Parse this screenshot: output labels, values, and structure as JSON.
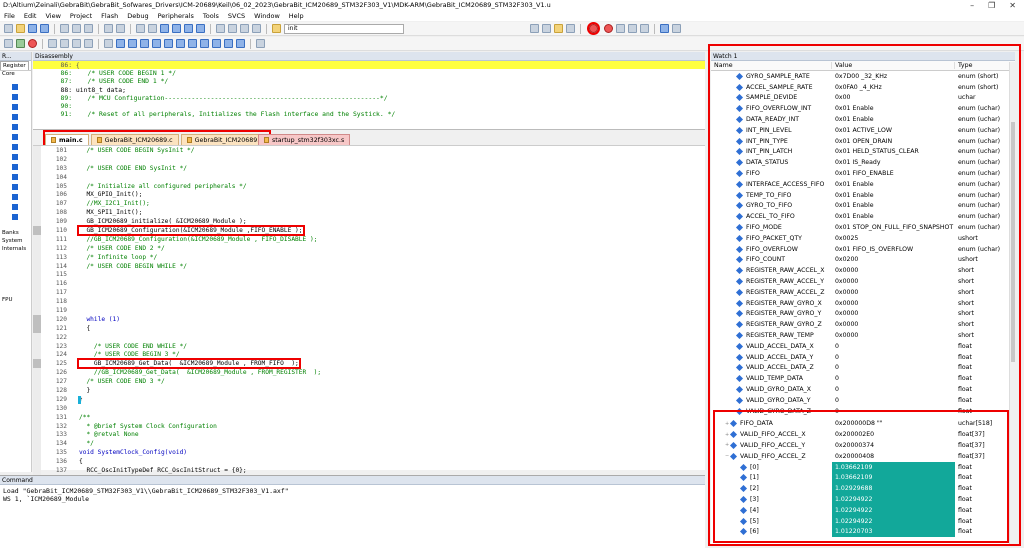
{
  "title": "D:\\Altium\\Zeinali\\GebraBit\\GebraBit_Sofwares_Drivers\\ICM-20689\\Keil\\06_02_2023\\GebraBit_ICM20689_STM32F303_V1\\MDK-ARM\\GebraBit_ICM20689_STM32F303_V1.u",
  "window_controls": [
    "–",
    "❐",
    "✕"
  ],
  "menu": [
    "File",
    "Edit",
    "View",
    "Project",
    "Flash",
    "Debug",
    "Peripherals",
    "Tools",
    "SVCS",
    "Window",
    "Help"
  ],
  "toolbar": {
    "find_value": "init"
  },
  "left_panel": {
    "header": "R...",
    "tab": "Register",
    "items": [
      "Core",
      "Banks",
      "System",
      "Internals",
      "FPU"
    ]
  },
  "disassembly": {
    "header": "Disassembly",
    "lines": [
      {
        "text": "   86: {"
      },
      {
        "text": "   86:    /* USER CODE BEGIN 1 */"
      },
      {
        "text": "   87:    /* USER CODE END 1 */"
      },
      {
        "text": "   88: uint8_t data;"
      },
      {
        "text": "   89:    /* MCU Configuration--------------------------------------------------------*/"
      },
      {
        "text": "   90:"
      },
      {
        "text": "   91:    /* Reset of all peripherals, Initializes the Flash interface and the Systick. */"
      }
    ]
  },
  "tabs": [
    {
      "label": "main.c"
    },
    {
      "label": "GebraBit_ICM20689.c"
    },
    {
      "label": "GebraBit_ICM20689.h"
    },
    {
      "label": "startup_stm32f303xc.s"
    }
  ],
  "editor": {
    "lines": [
      {
        "n": "101",
        "t": "  /* USER CODE BEGIN SysInit */"
      },
      {
        "n": "102",
        "t": ""
      },
      {
        "n": "103",
        "t": "  /* USER CODE END SysInit */"
      },
      {
        "n": "104",
        "t": ""
      },
      {
        "n": "105",
        "t": "  /* Initialize all configured peripherals */"
      },
      {
        "n": "106",
        "t": "  MX_GPIO_Init();"
      },
      {
        "n": "107",
        "t": "  //MX_I2C1_Init();"
      },
      {
        "n": "108",
        "t": "  MX_SPI1_Init();"
      },
      {
        "n": "109",
        "t": "  GB_ICM20689_initialize( &ICM20689_Module );"
      },
      {
        "n": "110",
        "t": "  GB_ICM20689_Configuration(&ICM20689_Module ,FIFO_ENABLE );"
      },
      {
        "n": "111",
        "t": "  //GB_ICM20689_Configuration(&ICM20689_Module , FIFO_DISABLE );"
      },
      {
        "n": "112",
        "t": "  /* USER CODE END 2 */"
      },
      {
        "n": "113",
        "t": "  /* Infinite loop */"
      },
      {
        "n": "114",
        "t": "  /* USER CODE BEGIN WHILE */"
      },
      {
        "n": "115",
        "t": ""
      },
      {
        "n": "116",
        "t": ""
      },
      {
        "n": "117",
        "t": ""
      },
      {
        "n": "118",
        "t": ""
      },
      {
        "n": "119",
        "t": ""
      },
      {
        "n": "120",
        "t": "  while (1)"
      },
      {
        "n": "121",
        "t": "  {"
      },
      {
        "n": "122",
        "t": ""
      },
      {
        "n": "123",
        "t": "    /* USER CODE END WHILE */"
      },
      {
        "n": "124",
        "t": "    /* USER CODE BEGIN 3 */"
      },
      {
        "n": "125",
        "t": "    GB_ICM20689_Get_Data(  &ICM20689_Module , FROM_FIFO  );"
      },
      {
        "n": "126",
        "t": "    //GB_ICM20689_Get_Data(  &ICM20689_Module , FROM_REGISTER  );"
      },
      {
        "n": "127",
        "t": "  /* USER CODE END 3 */"
      },
      {
        "n": "128",
        "t": "  }"
      },
      {
        "n": "129",
        "t": "}"
      },
      {
        "n": "130",
        "t": ""
      },
      {
        "n": "131",
        "t": "/**"
      },
      {
        "n": "132",
        "t": "  * @brief System Clock Configuration"
      },
      {
        "n": "133",
        "t": "  * @retval None"
      },
      {
        "n": "134",
        "t": "  */"
      },
      {
        "n": "135",
        "t": "void SystemClock_Config(void)"
      },
      {
        "n": "136",
        "t": "{"
      },
      {
        "n": "137",
        "t": "  RCC_OscInitTypeDef RCC_OscInitStruct = {0};"
      }
    ]
  },
  "command": {
    "header": "Command",
    "lines": [
      "Load \"GebraBit_ICM20689_STM32F303_V1\\\\GebraBit_ICM20689_STM32F303_V1.axf\"",
      "WS 1, `ICM20689_Module"
    ]
  },
  "watch": {
    "header": "Watch 1",
    "columns": [
      "Name",
      "Value",
      "Type"
    ],
    "rows": [
      {
        "name": "GYRO_SAMPLE_RATE",
        "value": "0x7D00 _32_KHz",
        "type": "enum (short)"
      },
      {
        "name": "ACCEL_SAMPLE_RATE",
        "value": "0x0FA0 _4_KHz",
        "type": "enum (short)"
      },
      {
        "name": "SAMPLE_DEVIDE",
        "value": "0x00",
        "type": "uchar"
      },
      {
        "name": "FIFO_OVERFLOW_INT",
        "value": "0x01 Enable",
        "type": "enum (uchar)"
      },
      {
        "name": "DATA_READY_INT",
        "value": "0x01 Enable",
        "type": "enum (uchar)"
      },
      {
        "name": "INT_PIN_LEVEL",
        "value": "0x01 ACTIVE_LOW",
        "type": "enum (uchar)"
      },
      {
        "name": "INT_PIN_TYPE",
        "value": "0x01 OPEN_DRAIN",
        "type": "enum (uchar)"
      },
      {
        "name": "INT_PIN_LATCH",
        "value": "0x01 HELD_STATUS_CLEAR",
        "type": "enum (uchar)"
      },
      {
        "name": "DATA_STATUS",
        "value": "0x01 IS_Ready",
        "type": "enum (uchar)"
      },
      {
        "name": "FIFO",
        "value": "0x01 FIFO_ENABLE",
        "type": "enum (uchar)"
      },
      {
        "name": "INTERFACE_ACCESS_FIFO",
        "value": "0x01 Enable",
        "type": "enum (uchar)"
      },
      {
        "name": "TEMP_TO_FIFO",
        "value": "0x01 Enable",
        "type": "enum (uchar)"
      },
      {
        "name": "GYRO_TO_FIFO",
        "value": "0x01 Enable",
        "type": "enum (uchar)"
      },
      {
        "name": "ACCEL_TO_FIFO",
        "value": "0x01 Enable",
        "type": "enum (uchar)"
      },
      {
        "name": "FIFO_MODE",
        "value": "0x01 STOP_ON_FULL_FIFO_SNAPSHOT",
        "type": "enum (uchar)"
      },
      {
        "name": "FIFO_PACKET_QTY",
        "value": "0x0025",
        "type": "ushort"
      },
      {
        "name": "FIFO_OVERFLOW",
        "value": "0x01 FIFO_IS_OVERFLOW",
        "type": "enum (uchar)"
      },
      {
        "name": "FIFO_COUNT",
        "value": "0x0200",
        "type": "ushort"
      },
      {
        "name": "REGISTER_RAW_ACCEL_X",
        "value": "0x0000",
        "type": "short"
      },
      {
        "name": "REGISTER_RAW_ACCEL_Y",
        "value": "0x0000",
        "type": "short"
      },
      {
        "name": "REGISTER_RAW_ACCEL_Z",
        "value": "0x0000",
        "type": "short"
      },
      {
        "name": "REGISTER_RAW_GYRO_X",
        "value": "0x0000",
        "type": "short"
      },
      {
        "name": "REGISTER_RAW_GYRO_Y",
        "value": "0x0000",
        "type": "short"
      },
      {
        "name": "REGISTER_RAW_GYRO_Z",
        "value": "0x0000",
        "type": "short"
      },
      {
        "name": "REGISTER_RAW_TEMP",
        "value": "0x0000",
        "type": "short"
      },
      {
        "name": "VALID_ACCEL_DATA_X",
        "value": "0",
        "type": "float"
      },
      {
        "name": "VALID_ACCEL_DATA_Y",
        "value": "0",
        "type": "float"
      },
      {
        "name": "VALID_ACCEL_DATA_Z",
        "value": "0",
        "type": "float"
      },
      {
        "name": "VALID_TEMP_DATA",
        "value": "0",
        "type": "float"
      },
      {
        "name": "VALID_GYRO_DATA_X",
        "value": "0",
        "type": "float"
      },
      {
        "name": "VALID_GYRO_DATA_Y",
        "value": "0",
        "type": "float"
      },
      {
        "name": "VALID_GYRO_DATA_Z",
        "value": "0",
        "type": "float"
      }
    ],
    "expanded_rows": [
      {
        "name": "FIFO_DATA",
        "value": "0x200000D8 \"\"",
        "type": "uchar[518]"
      },
      {
        "name": "VALID_FIFO_ACCEL_X",
        "value": "0x200002E0",
        "type": "float[37]"
      },
      {
        "name": "VALID_FIFO_ACCEL_Y",
        "value": "0x20000374",
        "type": "float[37]"
      },
      {
        "name": "VALID_FIFO_ACCEL_Z",
        "value": "0x20000408",
        "type": "float[37]"
      }
    ],
    "array_items": [
      {
        "name": "[0]",
        "value": "1.03662109",
        "type": "float"
      },
      {
        "name": "[1]",
        "value": "1.03662109",
        "type": "float"
      },
      {
        "name": "[2]",
        "value": "1.02929688",
        "type": "float"
      },
      {
        "name": "[3]",
        "value": "1.02294922",
        "type": "float"
      },
      {
        "name": "[4]",
        "value": "1.02294922",
        "type": "float"
      },
      {
        "name": "[5]",
        "value": "1.02294922",
        "type": "float"
      },
      {
        "name": "[6]",
        "value": "1.01220703",
        "type": "float"
      }
    ]
  }
}
